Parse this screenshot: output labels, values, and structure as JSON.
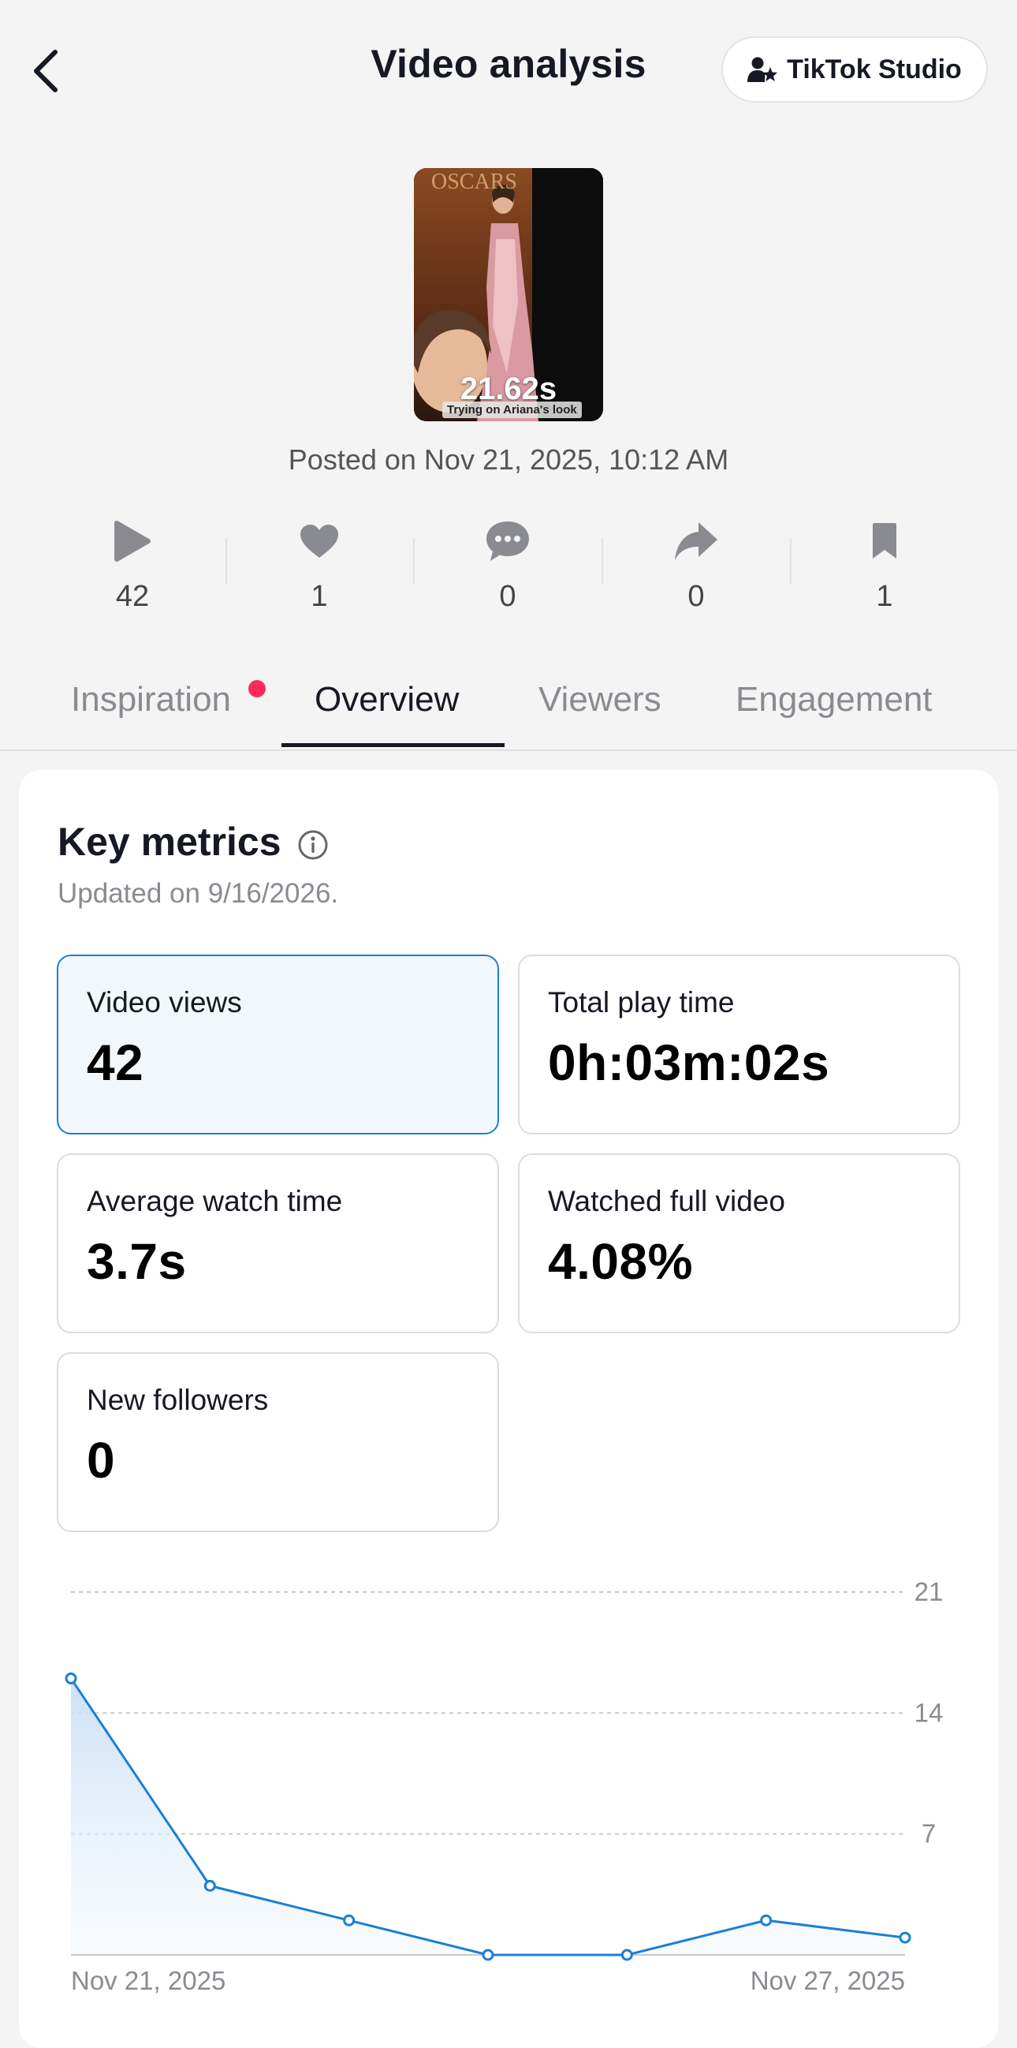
{
  "header": {
    "title": "Video analysis",
    "studio_label": "TikTok Studio"
  },
  "video": {
    "duration": "21.62s",
    "caption": "Trying on Ariana's look",
    "posted": "Posted on Nov 21, 2025, 10:12 AM"
  },
  "stats": {
    "views": "42",
    "likes": "1",
    "comments": "0",
    "shares": "0",
    "saves": "1"
  },
  "tabs": [
    "Inspiration",
    "Overview",
    "Viewers",
    "Engagement"
  ],
  "key_metrics": {
    "title": "Key metrics",
    "updated": "Updated on 9/16/2026.",
    "cards": [
      {
        "label": "Video views",
        "value": "42"
      },
      {
        "label": "Total play time",
        "value": "0h:03m:02s"
      },
      {
        "label": "Average watch time",
        "value": "3.7s"
      },
      {
        "label": "Watched full video",
        "value": "4.08%"
      },
      {
        "label": "New followers",
        "value": "0"
      }
    ]
  },
  "colors": {
    "accent": "#1b7fd6",
    "notification_dot": "#fe2c55"
  },
  "chart_data": {
    "type": "area",
    "x": [
      "2025-11-21",
      "2025-11-22",
      "2025-11-23",
      "2025-11-24",
      "2025-11-25",
      "2025-11-26",
      "2025-11-27"
    ],
    "x_tick_labels": [
      "Nov 21, 2025",
      "Nov 27, 2025"
    ],
    "values": [
      16,
      4,
      2,
      0,
      0,
      2,
      1
    ],
    "y_ticks": [
      "21",
      "14",
      "7"
    ],
    "ylim": [
      0,
      21
    ],
    "grid": true
  }
}
